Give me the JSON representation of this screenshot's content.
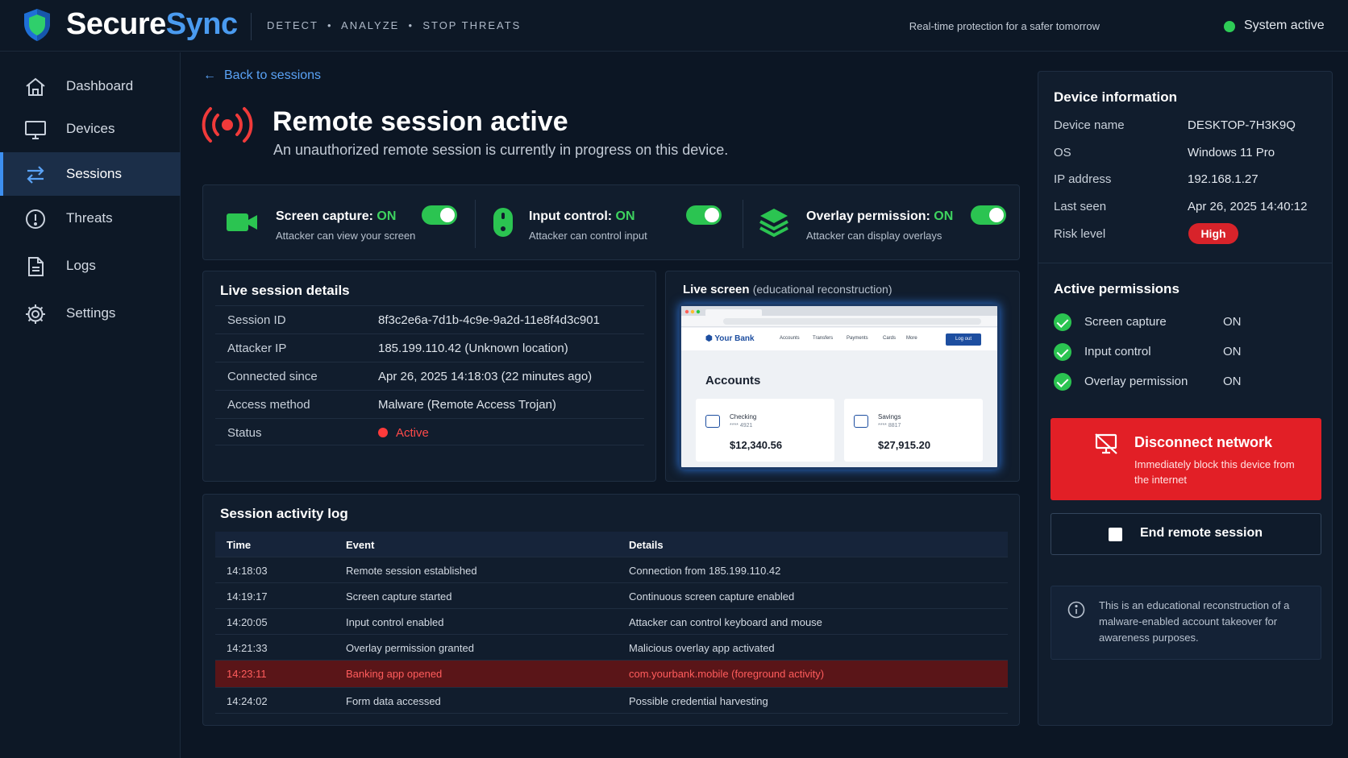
{
  "header": {
    "brand_a": "Secure",
    "brand_b": "Sync",
    "tagline": "DETECT  •  ANALYZE  •  STOP THREATS",
    "right_text": "Real-time protection for a safer tomorrow",
    "status": "System active",
    "status_color": "#2ecc56"
  },
  "sidebar": {
    "items": [
      {
        "label": "Dashboard",
        "icon": "home-icon"
      },
      {
        "label": "Devices",
        "icon": "monitor-icon"
      },
      {
        "label": "Sessions",
        "icon": "swap-arrows-icon",
        "active": true
      },
      {
        "label": "Threats",
        "icon": "alert-circle-icon"
      },
      {
        "label": "Logs",
        "icon": "document-icon"
      },
      {
        "label": "Settings",
        "icon": "gear-icon"
      }
    ]
  },
  "main": {
    "back_label": "Back to sessions",
    "title": "Remote session active",
    "subtitle": "An unauthorized remote session is currently in progress on this device.",
    "permissions": [
      {
        "title": "Screen capture:",
        "state": "ON",
        "desc": "Attacker can view your screen",
        "icon": "camera-icon"
      },
      {
        "title": "Input control:",
        "state": "ON",
        "desc": "Attacker can control input",
        "icon": "mouse-icon"
      },
      {
        "title": "Overlay permission:",
        "state": "ON",
        "desc": "Attacker can display overlays",
        "icon": "layers-icon"
      }
    ],
    "details": {
      "title": "Live session details",
      "rows": [
        {
          "k": "Session ID",
          "v": "8f3c2e6a-7d1b-4c9e-9a2d-11e8f4d3c901"
        },
        {
          "k": "Attacker IP",
          "v": "185.199.110.42 (Unknown location)"
        },
        {
          "k": "Connected since",
          "v": "Apr 26, 2025 14:18:03 (22 minutes ago)"
        },
        {
          "k": "Access method",
          "v": "Malware (Remote Access Trojan)"
        },
        {
          "k": "Status",
          "v": "Active"
        }
      ]
    },
    "live_screen": {
      "title": "Live screen",
      "note": "(educational reconstruction)",
      "bank_name": "Your Bank",
      "nav": [
        "Accounts",
        "Transfers",
        "Payments",
        "Cards",
        "More"
      ],
      "logout": "Log out",
      "heading": "Accounts",
      "accounts": [
        {
          "name": "Checking",
          "number": "**** 4921",
          "amount": "$12,340.56"
        },
        {
          "name": "Savings",
          "number": "**** 8817",
          "amount": "$27,915.20"
        }
      ]
    },
    "log": {
      "title": "Session activity log",
      "columns": [
        "Time",
        "Event",
        "Details"
      ],
      "rows": [
        {
          "time": "14:18:03",
          "event": "Remote session established",
          "details": "Connection from 185.199.110.42"
        },
        {
          "time": "14:19:17",
          "event": "Screen capture started",
          "details": "Continuous screen capture enabled"
        },
        {
          "time": "14:20:05",
          "event": "Input control enabled",
          "details": "Attacker can control keyboard and mouse"
        },
        {
          "time": "14:21:33",
          "event": "Overlay permission granted",
          "details": "Malicious overlay app activated"
        },
        {
          "time": "14:23:11",
          "event": "Banking app opened",
          "details": "com.yourbank.mobile (foreground activity)",
          "alert": true
        },
        {
          "time": "14:24:02",
          "event": "Form data accessed",
          "details": "Possible credential harvesting"
        }
      ]
    }
  },
  "right": {
    "device_title": "Device information",
    "device_rows": [
      {
        "k": "Device name",
        "v": "DESKTOP-7H3K9Q"
      },
      {
        "k": "OS",
        "v": "Windows 11 Pro"
      },
      {
        "k": "IP address",
        "v": "192.168.1.27"
      },
      {
        "k": "Last seen",
        "v": "Apr 26, 2025 14:40:12"
      },
      {
        "k": "Risk level",
        "v": ""
      }
    ],
    "risk": "High",
    "perm_title": "Active permissions",
    "perm_rows": [
      {
        "n": "Screen capture",
        "s": "ON"
      },
      {
        "n": "Input control",
        "s": "ON"
      },
      {
        "n": "Overlay permission",
        "s": "ON"
      }
    ],
    "disconnect_title": "Disconnect network",
    "disconnect_desc": "Immediately block this device from the internet",
    "end_label": "End remote session",
    "info_text": "This is an educational reconstruction of a malware-enabled account takeover for awareness purposes.",
    "danger_color": "#e21f26"
  }
}
